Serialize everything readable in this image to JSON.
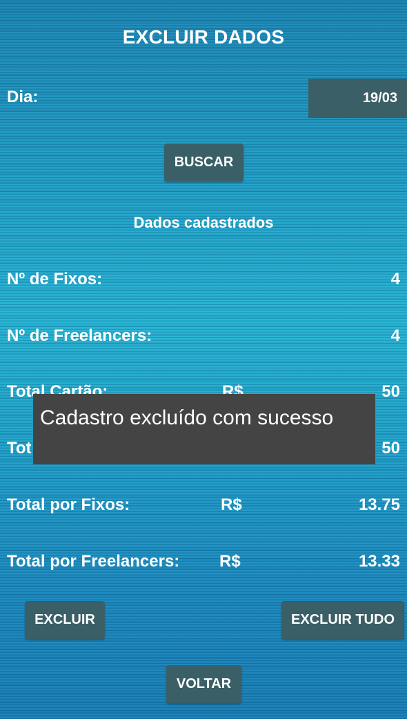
{
  "header": {
    "title": "EXCLUIR DADOS"
  },
  "dia": {
    "label": "Dia:",
    "value": "19/03"
  },
  "buttons": {
    "buscar": "BUSCAR",
    "excluir": "EXCLUIR",
    "excluir_tudo": "EXCLUIR TUDO",
    "voltar": "VOLTAR"
  },
  "section_title": "Dados cadastrados",
  "rows": {
    "fixos": {
      "label": "Nº de Fixos:",
      "value": "4"
    },
    "freelancers": {
      "label": "Nº de Freelancers:",
      "value": "4"
    },
    "total_cartao": {
      "label": "Total Cartão:",
      "currency": "R$",
      "value": "50"
    },
    "total_dinheiro": {
      "label": "Tot",
      "value": "50"
    },
    "total_fixos": {
      "label": "Total por Fixos:",
      "currency": "R$",
      "value": "13.75"
    },
    "total_freelancers": {
      "label": "Total por Freelancers:",
      "currency": "R$",
      "value": "13.33"
    }
  },
  "toast": {
    "message": "Cadastro excluído com sucesso"
  }
}
